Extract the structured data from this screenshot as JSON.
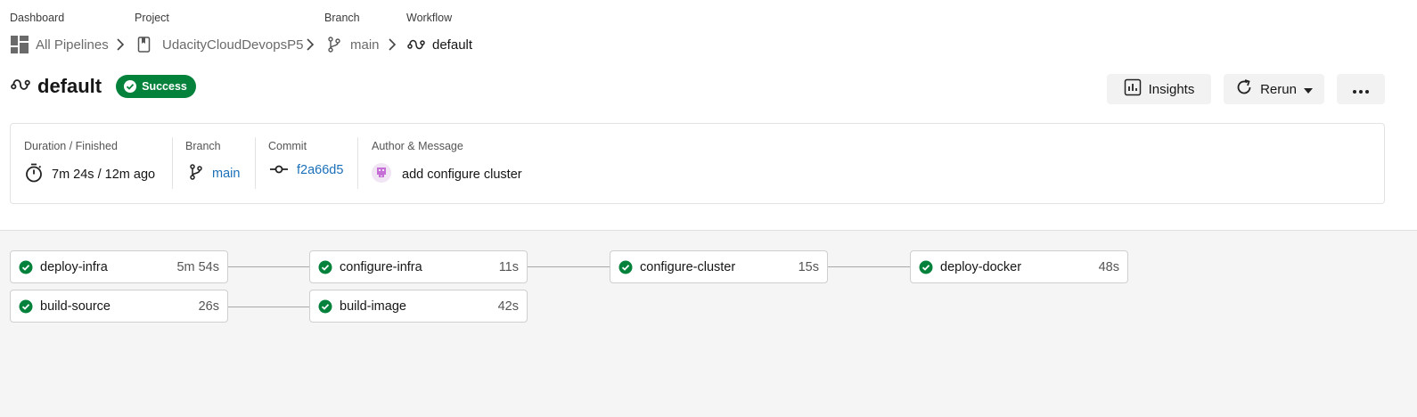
{
  "breadcrumb": {
    "dashboard": {
      "label": "Dashboard",
      "value": "All Pipelines"
    },
    "project": {
      "label": "Project",
      "value": "UdacityCloudDevopsP5"
    },
    "branch": {
      "label": "Branch",
      "value": "main"
    },
    "workflow": {
      "label": "Workflow",
      "value": "default"
    }
  },
  "header": {
    "title": "default",
    "status": "Success",
    "status_color": "#04823b",
    "insights_label": "Insights",
    "rerun_label": "Rerun"
  },
  "summary": {
    "duration_label": "Duration / Finished",
    "duration": "7m 24s",
    "finished": "12m ago",
    "duration_sep": "/",
    "branch_label": "Branch",
    "branch": "main",
    "commit_label": "Commit",
    "commit": "f2a66d5",
    "author_label": "Author & Message",
    "message": "add configure cluster",
    "link_color": "#1a6fb8"
  },
  "jobs": [
    {
      "name": "deploy-infra",
      "duration": "5m 54s",
      "status": "success"
    },
    {
      "name": "build-source",
      "duration": "26s",
      "status": "success"
    },
    {
      "name": "configure-infra",
      "duration": "11s",
      "status": "success"
    },
    {
      "name": "build-image",
      "duration": "42s",
      "status": "success"
    },
    {
      "name": "configure-cluster",
      "duration": "15s",
      "status": "success"
    },
    {
      "name": "deploy-docker",
      "duration": "48s",
      "status": "success"
    }
  ]
}
